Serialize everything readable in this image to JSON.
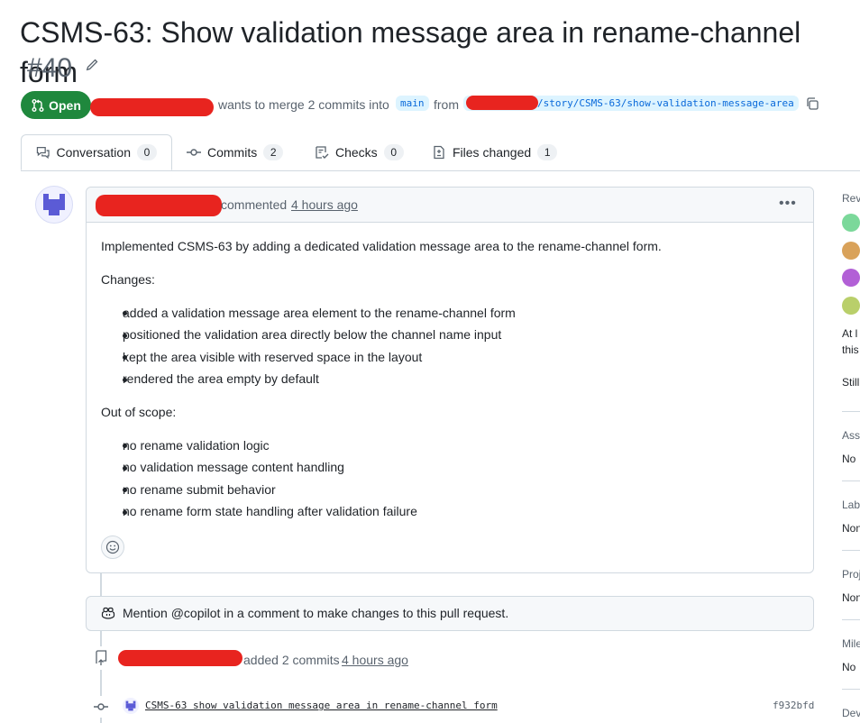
{
  "pr": {
    "title": "CSMS-63: Show validation message area in rename-channel form",
    "number": "#40",
    "state_label": "Open",
    "merge_text": "wants to merge 2 commits into",
    "base_branch": "main",
    "from_text": "from",
    "head_branch": "/story/CSMS-63/show-validation-message-area"
  },
  "tabs": [
    {
      "label": "Conversation",
      "count": "0"
    },
    {
      "label": "Commits",
      "count": "2"
    },
    {
      "label": "Checks",
      "count": "0"
    },
    {
      "label": "Files changed",
      "count": "1"
    }
  ],
  "comment": {
    "action": "commented",
    "time": "4 hours ago",
    "intro": "Implemented CSMS-63 by adding a dedicated validation message area to the rename-channel form.",
    "changes_heading": "Changes:",
    "changes": [
      "added a validation message area element to the rename-channel form",
      "positioned the validation area directly below the channel name input",
      "kept the area visible with reserved space in the layout",
      "rendered the area empty by default"
    ],
    "scope_heading": "Out of scope:",
    "out_of_scope": [
      "no rename validation logic",
      "no validation message content handling",
      "no rename submit behavior",
      "no rename form state handling after validation failure"
    ]
  },
  "copilot": {
    "text": "Mention @copilot in a comment to make changes to this pull request."
  },
  "commits_event": {
    "action": "added 2 commits",
    "time": "4 hours ago"
  },
  "commit": {
    "message": "CSMS-63 show validation message area in rename-channel form",
    "sha": "f932bfd"
  },
  "sidebar": {
    "reviewers": "Rev",
    "review_note_1": "At l",
    "review_note_2": "this",
    "still": "Still",
    "assignees": "Ass",
    "assignees_val": "No",
    "labels": "Lab",
    "labels_val": "Non",
    "projects": "Proj",
    "projects_val": "Non",
    "milestone": "Mile",
    "milestone_val": "No",
    "development": "Dev"
  },
  "colors": {
    "open_green": "#1f883d",
    "link_blue": "#0969da",
    "redaction_red": "#e8241f"
  }
}
